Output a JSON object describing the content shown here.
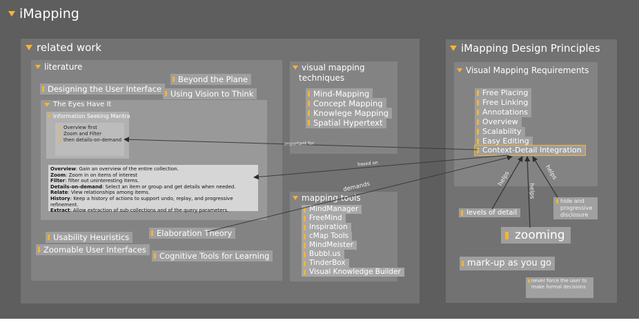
{
  "colors": {
    "canvas": "#5e5e5e",
    "accent": "#f6b431",
    "text": "#ffffff"
  },
  "root": {
    "title": "iMapping"
  },
  "related_work": {
    "title": "related work",
    "literature": {
      "title": "literature",
      "items": {
        "beyond_plane": "Beyond the Plane",
        "designing_ui": "Designing the User Interface",
        "using_vision": "Using Vision to Think",
        "usability": "Usability Heuristics",
        "zoomable_ui": "Zoomable User Interfaces",
        "elaboration": "Elaboration Theory",
        "cognitive_tools": "Cognitive Tools for Learning"
      },
      "eyes": {
        "title": "The Eyes Have It",
        "mantra": {
          "title": "Information Seeking Mantra",
          "items": [
            "Overview first",
            "Zoom and Filter",
            "then details-on-demand"
          ]
        },
        "description": [
          {
            "term": "Overview",
            "text": ": Gain an overview of the entire collection."
          },
          {
            "term": "Zoom",
            "text": ": Zoom in on items of interest"
          },
          {
            "term": "Filter",
            "text": ": filter out uninteresting items."
          },
          {
            "term": "Details-on-demand",
            "text": ": Select an item or group and get details when needed."
          },
          {
            "term": "Relate",
            "text": ": View relationships among items."
          },
          {
            "term": "History",
            "text": ": Keep a history of actions to support undo, replay, and progressive refinement."
          },
          {
            "term": "Extract",
            "text": ": Allow extraction of sub-collections and of the query parameters."
          }
        ]
      }
    },
    "techniques": {
      "title_line1": "visual mapping",
      "title_line2": "techniques",
      "items": [
        "Mind-Mapping",
        "Concept Mapping",
        "Knowlege Mapping",
        "Spatial Hypertext"
      ]
    },
    "tools": {
      "title": "mapping tools",
      "items": [
        "MindManager",
        "FreeMind",
        "Inspiration",
        "cMap Tools",
        "MindMeister",
        "Bubbl.us",
        "TinderBox",
        "Visual Knowledge Builder"
      ]
    }
  },
  "principles": {
    "title": "iMapping Design Principles",
    "requirements": {
      "title": "Visual Mapping Requirements",
      "items": [
        "Free Placing",
        "Free Linking",
        "Annotations",
        "Overview",
        "Scalability",
        "Easy Editing",
        "Context-Detail Integration"
      ]
    },
    "levels_of_detail": "levels of detail",
    "hide_line1": "hide and",
    "hide_line2": "progressive",
    "hide_line3": "disclosure",
    "zooming": "zooming",
    "markup": "mark-up as you go",
    "never_force": "never force the user to make formal decisions"
  },
  "links": {
    "important_for": "important for",
    "based_on": "based on",
    "demands": "demands",
    "helps": "helps"
  }
}
